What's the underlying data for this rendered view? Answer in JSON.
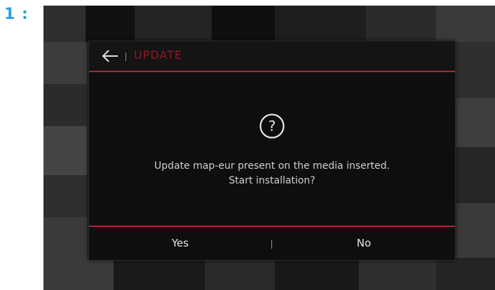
{
  "step_label": "1 :",
  "dialog": {
    "title": "UPDATE",
    "back_icon": "back-arrow-icon",
    "question_icon": "question-circle-icon",
    "message_line1": "Update map-eur present on the media inserted.",
    "message_line2": "Start installation?",
    "yes_label": "Yes",
    "no_label": "No"
  },
  "colors": {
    "accent_red": "#b02236",
    "title_red": "#8c1a24",
    "step_label_blue": "#2aa0dc",
    "dialog_bg": "#0e0e0e",
    "text": "#d0d0d0"
  }
}
